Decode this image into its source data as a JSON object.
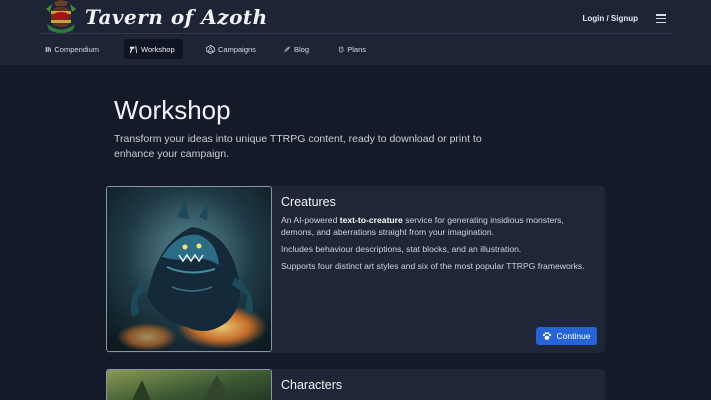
{
  "header": {
    "brand": "Tavern of Azoth",
    "login_label": "Login / Signup",
    "menu_icon": "hamburger-icon",
    "logo_icon": "tavern-logo-icon"
  },
  "nav": {
    "items": [
      {
        "label": "Compendium",
        "icon": "book-icon",
        "active": false
      },
      {
        "label": "Workshop",
        "icon": "tools-icon",
        "active": true
      },
      {
        "label": "Campaigns",
        "icon": "d20-icon",
        "active": false
      },
      {
        "label": "Blog",
        "icon": "quill-icon",
        "active": false
      },
      {
        "label": "Plans",
        "icon": "scroll-icon",
        "active": false
      }
    ]
  },
  "main": {
    "title": "Workshop",
    "intro": "Transform your ideas into unique TTRPG content, ready to download or print to enhance your campaign."
  },
  "cards": [
    {
      "title": "Creatures",
      "desc_pre": "An AI-powered ",
      "desc_bold": "text-to-creature",
      "desc_post": " service for generating insidious monsters, demons, and aberrations straight from your imagination.",
      "line2": "Includes behaviour descriptions, stat blocks, and an illustration.",
      "line3": "Supports four distinct art styles and six of the most popular TTRPG frameworks.",
      "button_label": "Continue",
      "button_icon": "paw-icon"
    },
    {
      "title": "Characters"
    }
  ],
  "colors": {
    "background": "#151a28",
    "header": "#1d2435",
    "card": "#1f2637",
    "accent": "#2563d6"
  }
}
